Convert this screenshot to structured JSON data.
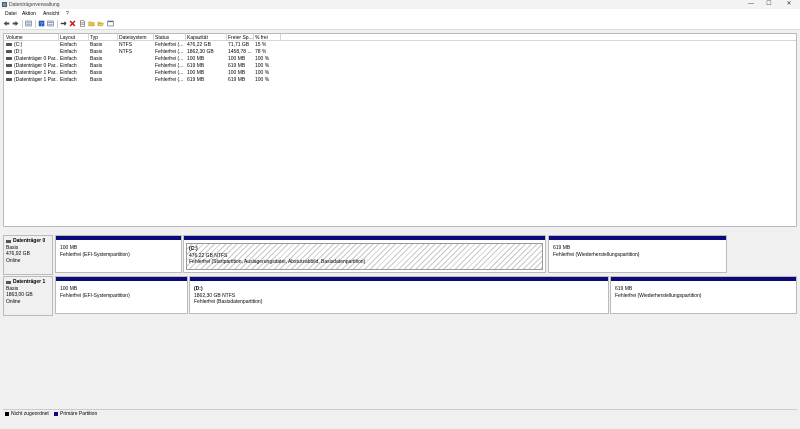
{
  "window": {
    "title": "Datenträgerverwaltung",
    "controls": [
      "—",
      "☐",
      "✕"
    ]
  },
  "menu": [
    "Datei",
    "Aktion",
    "Ansicht",
    "?"
  ],
  "toolbar": {
    "icons": [
      "back-arrow-icon",
      "forward-arrow-icon",
      "list-view-icon",
      "help-icon",
      "properties-icon",
      "connect-icon",
      "delete-icon",
      "document-icon",
      "folder-icon",
      "open-folder-icon",
      "window-icon"
    ]
  },
  "table": {
    "columns": [
      "Volume",
      "Layout",
      "Typ",
      "Dateisystem",
      "Status",
      "Kapazität",
      "Freier Sp...",
      "% frei"
    ],
    "rows": [
      [
        "(C:)",
        "Einfach",
        "Basis",
        "NTFS",
        "Fehlerfrei (...",
        "476,22 GB",
        "71,71 GB",
        "15 %"
      ],
      [
        "(D:)",
        "Einfach",
        "Basis",
        "NTFS",
        "Fehlerfrei (...",
        "1862,30 GB",
        "1458,78 ...",
        "78 %"
      ],
      [
        "(Datenträger 0 Par...",
        "Einfach",
        "Basis",
        "",
        "Fehlerfrei (...",
        "100 MB",
        "100 MB",
        "100 %"
      ],
      [
        "(Datenträger 0 Par...",
        "Einfach",
        "Basis",
        "",
        "Fehlerfrei (...",
        "619 MB",
        "619 MB",
        "100 %"
      ],
      [
        "(Datenträger 1 Par...",
        "Einfach",
        "Basis",
        "",
        "Fehlerfrei (...",
        "100 MB",
        "100 MB",
        "100 %"
      ],
      [
        "(Datenträger 1 Par...",
        "Einfach",
        "Basis",
        "",
        "Fehlerfrei (...",
        "619 MB",
        "619 MB",
        "100 %"
      ]
    ]
  },
  "disks": [
    {
      "name": "Datenträger 0",
      "type": "Basis",
      "size": "476,92 GB",
      "state": "Online",
      "partitions": [
        {
          "label": "",
          "size": "100 MB",
          "status": "Fehlerfrei (EFI-Systempartition)"
        },
        {
          "label": "(C:)",
          "size": "476,22 GB NTFS",
          "status": "Fehlerfrei (Startpartition, Auslagerungsdatei, Absturzabbild, Basisdatenpartition)"
        },
        {
          "label": "",
          "size": "619 MB",
          "status": "Fehlerfrei (Wiederherstellungspartition)"
        }
      ]
    },
    {
      "name": "Datenträger 1",
      "type": "Basis",
      "size": "1863,00 GB",
      "state": "Online",
      "partitions": [
        {
          "label": "",
          "size": "100 MB",
          "status": "Fehlerfrei (EFI-Systempartition)"
        },
        {
          "label": "(D:)",
          "size": "1862,30 GB NTFS",
          "status": "Fehlerfrei (Basisdatenpartition)"
        },
        {
          "label": "",
          "size": "619 MB",
          "status": "Fehlerfrei (Wiederherstellungspartition)"
        }
      ]
    }
  ],
  "legend": [
    {
      "label": "Nicht zugeordnet",
      "color": "#000000"
    },
    {
      "label": "Primäre Partition",
      "color": "#0a0a7a"
    }
  ]
}
